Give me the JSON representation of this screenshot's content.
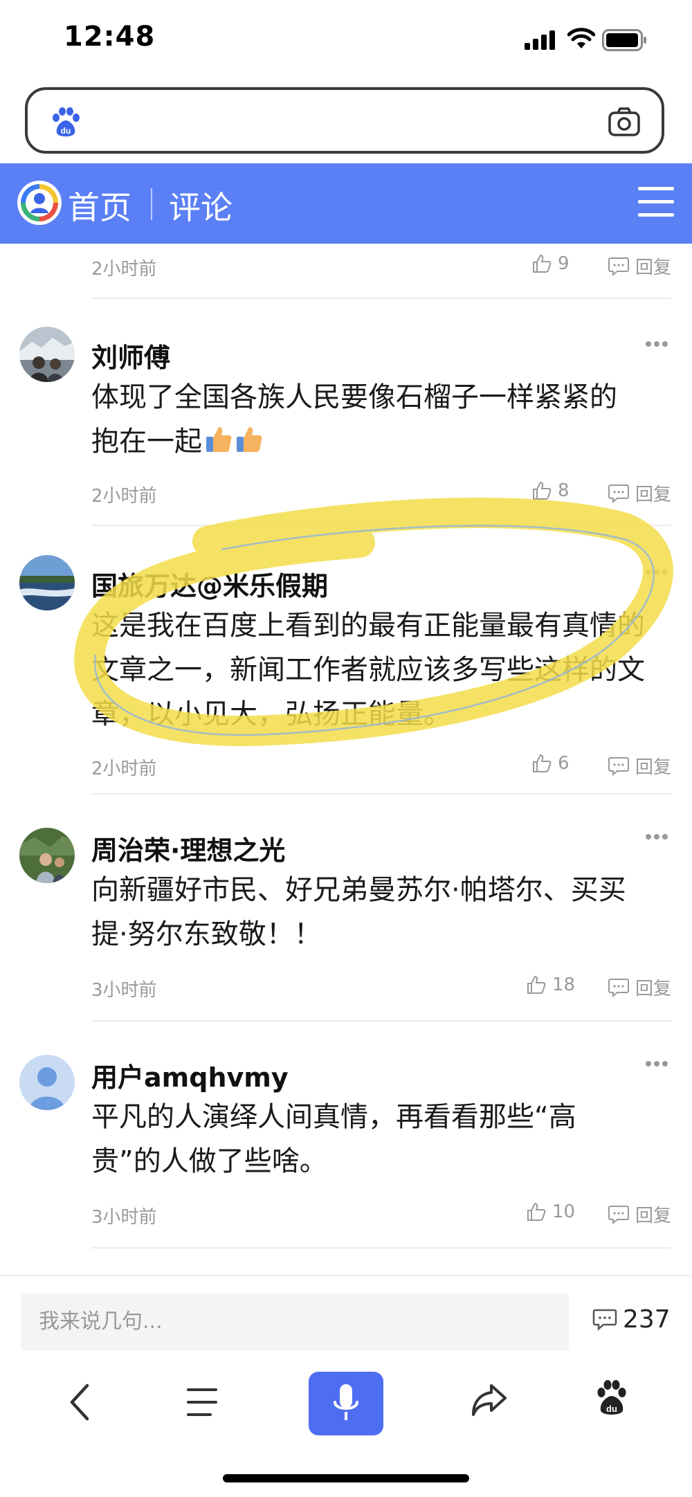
{
  "status_bar": {
    "time": "12:48"
  },
  "search_bar": {
    "placeholder": ""
  },
  "nav": {
    "home": "首页",
    "comments": "评论"
  },
  "comments": [
    {
      "username": "",
      "text": "",
      "time": "2小时前",
      "likes": "9",
      "reply": "回复"
    },
    {
      "username": "刘师傅",
      "text": "体现了全国各族人民要像石榴子一样紧紧的抱在一起",
      "time": "2小时前",
      "likes": "8",
      "reply": "回复"
    },
    {
      "username": "国旅万达@米乐假期",
      "text": "这是我在百度上看到的最有正能量最有真情的文章之一，新闻工作者就应该多写些这样的文章，以小见大，弘扬正能量。",
      "time": "2小时前",
      "likes": "6",
      "reply": "回复"
    },
    {
      "username": "周治荣·理想之光",
      "text": "向新疆好市民、好兄弟曼苏尔·帕塔尔、买买提·努尔东致敬！！",
      "time": "3小时前",
      "likes": "18",
      "reply": "回复"
    },
    {
      "username": "用户amqhvmy",
      "text": "平凡的人演绎人间真情，再看看那些“高贵”的人做了些啥。",
      "time": "3小时前",
      "likes": "10",
      "reply": "回复"
    }
  ],
  "comment_bar": {
    "placeholder": "我来说几句...",
    "count": "237"
  },
  "colors": {
    "brand_blue": "#5b7ff5",
    "voice_blue": "#4e6ef2",
    "highlight": "#f3dd4a"
  },
  "icons": [
    "signal-icon",
    "wifi-icon",
    "battery-icon",
    "baidu-paw-icon",
    "camera-icon",
    "menu-icon",
    "thumbs-up-icon",
    "reply-bubble-icon",
    "more-icon",
    "back-icon",
    "list-icon",
    "microphone-icon",
    "share-icon"
  ]
}
